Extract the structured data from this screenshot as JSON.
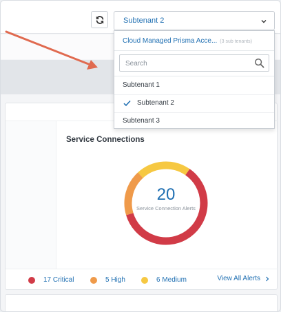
{
  "header": {
    "refresh_icon": "refresh-icon",
    "tenant_select": {
      "value": "Subtenant 2",
      "icon": "chevron-down-icon"
    }
  },
  "dropdown": {
    "header": {
      "title": "Cloud Managed Prisma Acce...",
      "count": "(3 sub tenants)"
    },
    "search": {
      "placeholder": "Search",
      "icon": "search-icon"
    },
    "items": [
      {
        "label": "Subtenant 1",
        "selected": false
      },
      {
        "label": "Subtenant 2",
        "selected": true
      },
      {
        "label": "Subtenant 3",
        "selected": false
      }
    ]
  },
  "service_connections": {
    "title": "Service Connections",
    "total": "20",
    "label": "Service Connection Alerts",
    "legend": [
      {
        "label": "17 Critical",
        "color": "#d13b47"
      },
      {
        "label": "5 High",
        "color": "#ef9a4a"
      },
      {
        "label": "6 Medium",
        "color": "#f6c842"
      }
    ],
    "view_all": "View All Alerts"
  },
  "chart_data": {
    "type": "pie",
    "center_value": 20,
    "center_label": "Service Connection Alerts",
    "categories": [
      "Critical",
      "High",
      "Medium"
    ],
    "values": [
      17,
      5,
      6
    ],
    "colors": [
      "#d13b47",
      "#ef9a4a",
      "#f6c842"
    ]
  },
  "annotation": {
    "color": "#e06a4f",
    "icon": "arrow-annotation"
  }
}
